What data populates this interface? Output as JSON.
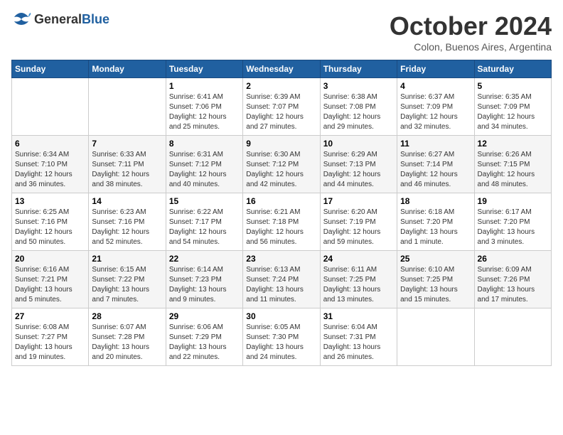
{
  "logo": {
    "general": "General",
    "blue": "Blue"
  },
  "title": "October 2024",
  "subtitle": "Colon, Buenos Aires, Argentina",
  "days_of_week": [
    "Sunday",
    "Monday",
    "Tuesday",
    "Wednesday",
    "Thursday",
    "Friday",
    "Saturday"
  ],
  "weeks": [
    [
      {
        "num": "",
        "info": ""
      },
      {
        "num": "",
        "info": ""
      },
      {
        "num": "1",
        "info": "Sunrise: 6:41 AM\nSunset: 7:06 PM\nDaylight: 12 hours and 25 minutes."
      },
      {
        "num": "2",
        "info": "Sunrise: 6:39 AM\nSunset: 7:07 PM\nDaylight: 12 hours and 27 minutes."
      },
      {
        "num": "3",
        "info": "Sunrise: 6:38 AM\nSunset: 7:08 PM\nDaylight: 12 hours and 29 minutes."
      },
      {
        "num": "4",
        "info": "Sunrise: 6:37 AM\nSunset: 7:09 PM\nDaylight: 12 hours and 32 minutes."
      },
      {
        "num": "5",
        "info": "Sunrise: 6:35 AM\nSunset: 7:09 PM\nDaylight: 12 hours and 34 minutes."
      }
    ],
    [
      {
        "num": "6",
        "info": "Sunrise: 6:34 AM\nSunset: 7:10 PM\nDaylight: 12 hours and 36 minutes."
      },
      {
        "num": "7",
        "info": "Sunrise: 6:33 AM\nSunset: 7:11 PM\nDaylight: 12 hours and 38 minutes."
      },
      {
        "num": "8",
        "info": "Sunrise: 6:31 AM\nSunset: 7:12 PM\nDaylight: 12 hours and 40 minutes."
      },
      {
        "num": "9",
        "info": "Sunrise: 6:30 AM\nSunset: 7:12 PM\nDaylight: 12 hours and 42 minutes."
      },
      {
        "num": "10",
        "info": "Sunrise: 6:29 AM\nSunset: 7:13 PM\nDaylight: 12 hours and 44 minutes."
      },
      {
        "num": "11",
        "info": "Sunrise: 6:27 AM\nSunset: 7:14 PM\nDaylight: 12 hours and 46 minutes."
      },
      {
        "num": "12",
        "info": "Sunrise: 6:26 AM\nSunset: 7:15 PM\nDaylight: 12 hours and 48 minutes."
      }
    ],
    [
      {
        "num": "13",
        "info": "Sunrise: 6:25 AM\nSunset: 7:16 PM\nDaylight: 12 hours and 50 minutes."
      },
      {
        "num": "14",
        "info": "Sunrise: 6:23 AM\nSunset: 7:16 PM\nDaylight: 12 hours and 52 minutes."
      },
      {
        "num": "15",
        "info": "Sunrise: 6:22 AM\nSunset: 7:17 PM\nDaylight: 12 hours and 54 minutes."
      },
      {
        "num": "16",
        "info": "Sunrise: 6:21 AM\nSunset: 7:18 PM\nDaylight: 12 hours and 56 minutes."
      },
      {
        "num": "17",
        "info": "Sunrise: 6:20 AM\nSunset: 7:19 PM\nDaylight: 12 hours and 59 minutes."
      },
      {
        "num": "18",
        "info": "Sunrise: 6:18 AM\nSunset: 7:20 PM\nDaylight: 13 hours and 1 minute."
      },
      {
        "num": "19",
        "info": "Sunrise: 6:17 AM\nSunset: 7:20 PM\nDaylight: 13 hours and 3 minutes."
      }
    ],
    [
      {
        "num": "20",
        "info": "Sunrise: 6:16 AM\nSunset: 7:21 PM\nDaylight: 13 hours and 5 minutes."
      },
      {
        "num": "21",
        "info": "Sunrise: 6:15 AM\nSunset: 7:22 PM\nDaylight: 13 hours and 7 minutes."
      },
      {
        "num": "22",
        "info": "Sunrise: 6:14 AM\nSunset: 7:23 PM\nDaylight: 13 hours and 9 minutes."
      },
      {
        "num": "23",
        "info": "Sunrise: 6:13 AM\nSunset: 7:24 PM\nDaylight: 13 hours and 11 minutes."
      },
      {
        "num": "24",
        "info": "Sunrise: 6:11 AM\nSunset: 7:25 PM\nDaylight: 13 hours and 13 minutes."
      },
      {
        "num": "25",
        "info": "Sunrise: 6:10 AM\nSunset: 7:25 PM\nDaylight: 13 hours and 15 minutes."
      },
      {
        "num": "26",
        "info": "Sunrise: 6:09 AM\nSunset: 7:26 PM\nDaylight: 13 hours and 17 minutes."
      }
    ],
    [
      {
        "num": "27",
        "info": "Sunrise: 6:08 AM\nSunset: 7:27 PM\nDaylight: 13 hours and 19 minutes."
      },
      {
        "num": "28",
        "info": "Sunrise: 6:07 AM\nSunset: 7:28 PM\nDaylight: 13 hours and 20 minutes."
      },
      {
        "num": "29",
        "info": "Sunrise: 6:06 AM\nSunset: 7:29 PM\nDaylight: 13 hours and 22 minutes."
      },
      {
        "num": "30",
        "info": "Sunrise: 6:05 AM\nSunset: 7:30 PM\nDaylight: 13 hours and 24 minutes."
      },
      {
        "num": "31",
        "info": "Sunrise: 6:04 AM\nSunset: 7:31 PM\nDaylight: 13 hours and 26 minutes."
      },
      {
        "num": "",
        "info": ""
      },
      {
        "num": "",
        "info": ""
      }
    ]
  ]
}
